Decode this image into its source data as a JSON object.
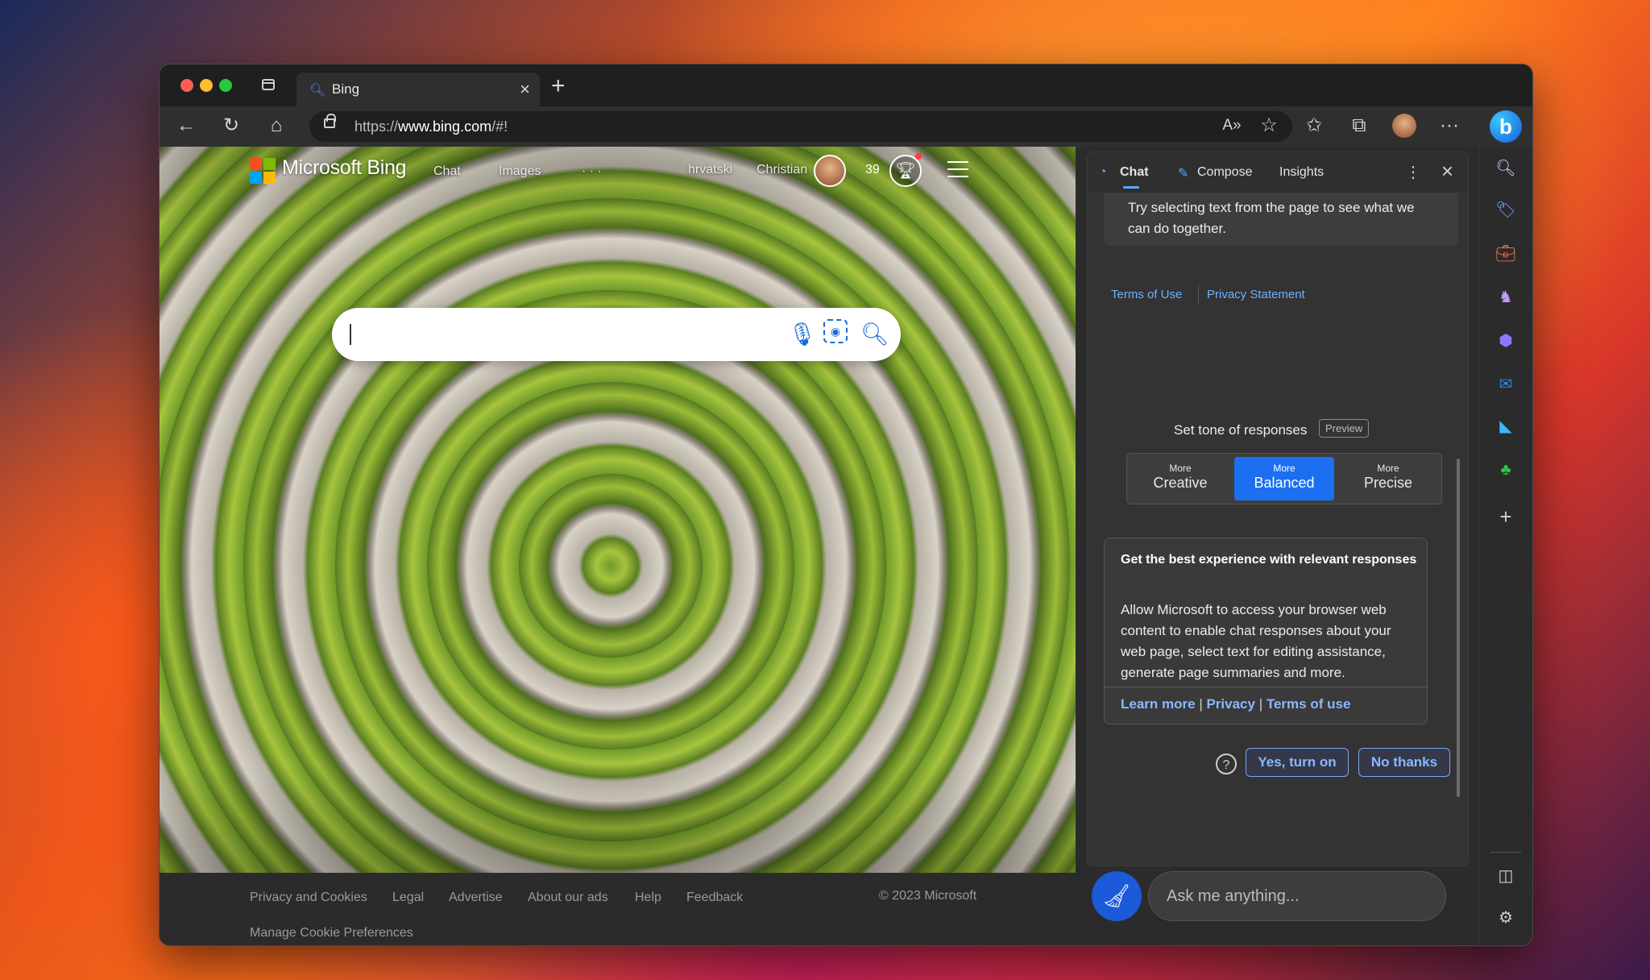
{
  "browser": {
    "tab_title": "Bing",
    "url_prefix": "https://",
    "url_host": "www.bing.com",
    "url_path": "/#!"
  },
  "bing": {
    "brand": "Microsoft Bing",
    "nav": [
      "Chat",
      "Images",
      "· · ·",
      "hrvatski",
      "Christian"
    ],
    "points": "39"
  },
  "footer": {
    "links": [
      "Privacy and Cookies",
      "Legal",
      "Advertise",
      "About our ads",
      "Help",
      "Feedback"
    ],
    "copyright": "© 2023 Microsoft",
    "cookie_prefs": "Manage Cookie Preferences"
  },
  "sidebar": {
    "tabs": [
      "Chat",
      "Compose",
      "Insights"
    ],
    "message": "Try selecting text from the page to see what we can do together.",
    "terms": "Terms of Use",
    "privacy": "Privacy Statement",
    "tone_label": "Set tone of responses",
    "preview": "Preview",
    "tones": [
      {
        "small": "More",
        "large": "Creative"
      },
      {
        "small": "More",
        "large": "Balanced"
      },
      {
        "small": "More",
        "large": "Precise"
      }
    ],
    "perm_title": "Get the best experience with relevant responses",
    "perm_body": "Allow Microsoft to access your browser web content to enable chat responses about your web page, select text for editing assistance, generate page summaries and more.",
    "perm_links": [
      "Learn more",
      "Privacy",
      "Terms of use"
    ],
    "yes_btn": "Yes, turn on",
    "no_btn": "No thanks",
    "ask_placeholder": "Ask me anything..."
  },
  "colors": {
    "accent": "#1b6ff0",
    "link": "#6fb0ff"
  }
}
